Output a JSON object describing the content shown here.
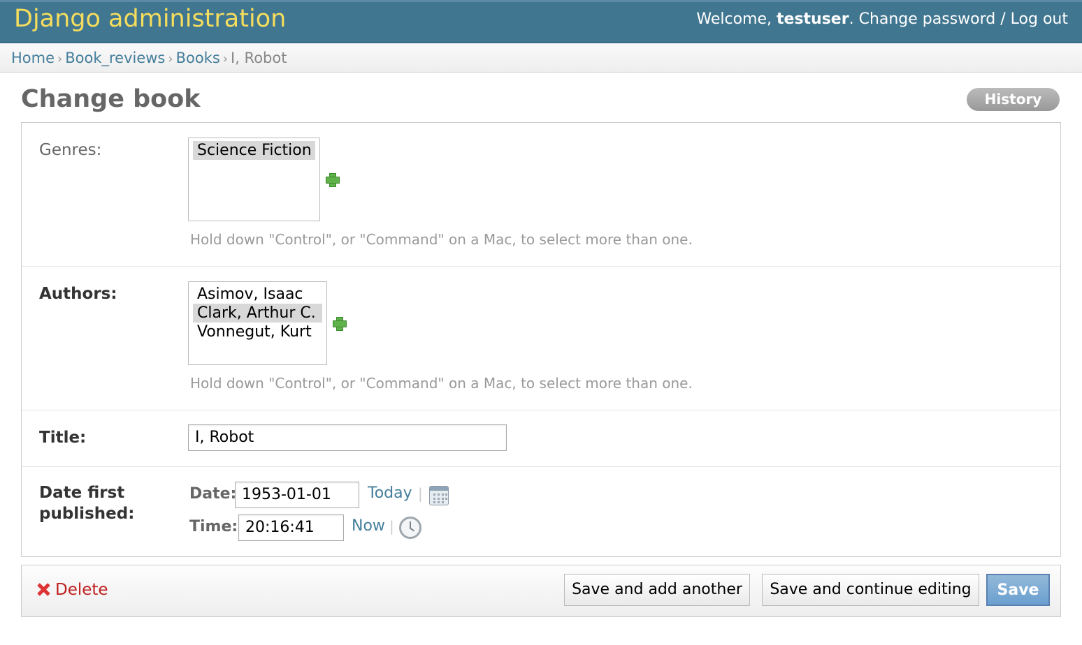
{
  "header": {
    "branding": "Django administration",
    "welcome_prefix": "Welcome, ",
    "username": "testuser",
    "welcome_suffix": ".",
    "change_password": "Change password",
    "separator": "/",
    "logout": "Log out",
    "colors": {
      "bar": "#417690",
      "branding": "#f5dd5d"
    }
  },
  "breadcrumbs": [
    {
      "label": "Home"
    },
    {
      "label": "Book_reviews"
    },
    {
      "label": "Books"
    },
    {
      "label": "I, Robot"
    }
  ],
  "breadcrumb_separator": "›",
  "page": {
    "title": "Change book",
    "history_button": "History"
  },
  "form": {
    "genres": {
      "label": "Genres:",
      "options": [
        {
          "text": "Science Fiction",
          "selected": true
        }
      ],
      "help": "Hold down \"Control\", or \"Command\" on a Mac, to select more than one."
    },
    "authors": {
      "label": "Authors:",
      "options": [
        {
          "text": "Asimov, Isaac",
          "selected": false
        },
        {
          "text": "Clark, Arthur C.",
          "selected": true
        },
        {
          "text": "Vonnegut, Kurt",
          "selected": false
        }
      ],
      "help": "Hold down \"Control\", or \"Command\" on a Mac, to select more than one."
    },
    "title": {
      "label": "Title:",
      "value": "I, Robot"
    },
    "date_first_published": {
      "label_line1": "Date first",
      "label_line2": "published:",
      "date_label": "Date:",
      "date_value": "1953-01-01",
      "today_link": "Today",
      "time_label": "Time:",
      "time_value": "20:16:41",
      "now_link": "Now",
      "pipe": "|"
    }
  },
  "submit_row": {
    "delete": "Delete",
    "save_add_another": "Save and add another",
    "save_continue": "Save and continue editing",
    "save": "Save"
  }
}
